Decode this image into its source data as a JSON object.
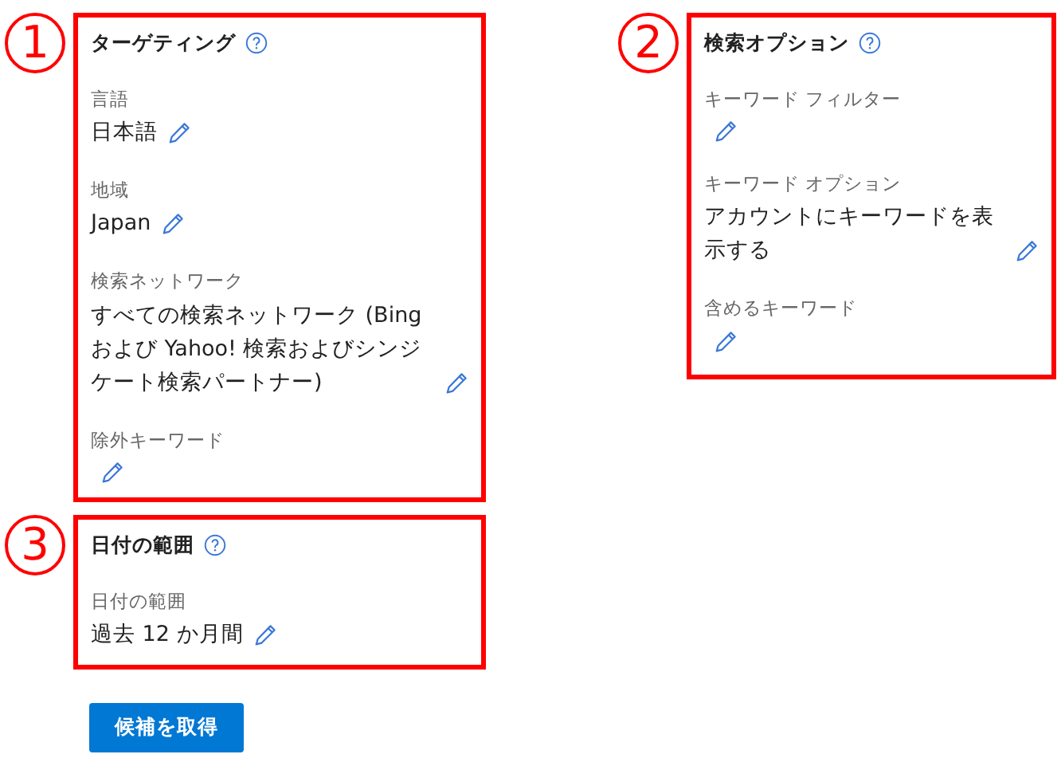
{
  "sections": [
    {
      "marker": "1",
      "title": "ターゲティング",
      "fields": [
        {
          "label": "言語",
          "value": "日本語"
        },
        {
          "label": "地域",
          "value": "Japan"
        },
        {
          "label": "検索ネットワーク",
          "value": "すべての検索ネットワーク (Bing および Yahoo! 検索およびシンジケート検索パートナー)"
        },
        {
          "label": "除外キーワード"
        }
      ]
    },
    {
      "marker": "2",
      "title": "検索オプション",
      "fields": [
        {
          "label": "キーワード フィルター"
        },
        {
          "label": "キーワード オプション",
          "value": "アカウントにキーワードを表示する"
        },
        {
          "label": "含めるキーワード"
        }
      ]
    },
    {
      "marker": "3",
      "title": "日付の範囲",
      "fields": [
        {
          "label": "日付の範囲",
          "value": "過去 12 か月間"
        }
      ]
    }
  ],
  "button": "候補を取得"
}
